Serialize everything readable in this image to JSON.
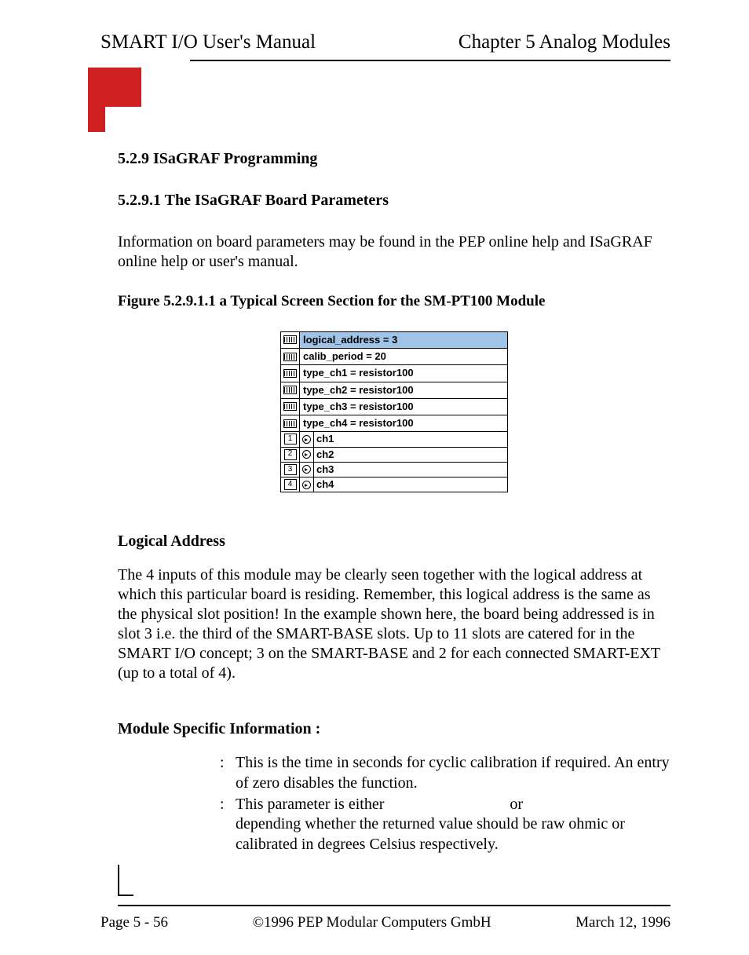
{
  "header": {
    "manual_title": "SMART I/O User's Manual",
    "chapter_title": "Chapter 5   Analog Modules"
  },
  "headings": {
    "h1": "5.2.9 ISaGRAF Programming",
    "h2": "5.2.9.1 The ISaGRAF Board Parameters",
    "intro_para": "Information on board parameters may be found in the PEP online help and ISaGRAF online help or user's manual.",
    "figure_title": "Figure 5.2.9.1.1 a Typical Screen Section for the SM-PT100 Module"
  },
  "screenshot": {
    "params": [
      {
        "text": "logical_address = 3",
        "highlight": true
      },
      {
        "text": "calib_period = 20",
        "highlight": false
      },
      {
        "text": "type_ch1 = resistor100",
        "highlight": false
      },
      {
        "text": "type_ch2 = resistor100",
        "highlight": false
      },
      {
        "text": "type_ch3 = resistor100",
        "highlight": false
      },
      {
        "text": "type_ch4 = resistor100",
        "highlight": false
      }
    ],
    "channels": [
      {
        "num": "1",
        "label": "ch1"
      },
      {
        "num": "2",
        "label": "ch2"
      },
      {
        "num": "3",
        "label": "ch3"
      },
      {
        "num": "4",
        "label": "ch4"
      }
    ]
  },
  "logical_address": {
    "title": "Logical Address",
    "text": "The 4 inputs of this module may be clearly seen together with the logical address at which this particular board is residing. Remember, this logical address is the same as the physical slot position! In the example shown here, the board being addressed is in slot 3 i.e. the third of the SMART-BASE slots. Up to 11 slots are catered for in the SMART I/O concept; 3 on the SMART-BASE and 2 for each connected SMART-EXT (up to a total of 4)."
  },
  "module_info": {
    "title": "Module Specific Information :",
    "rows": [
      {
        "term": "",
        "colon": ":",
        "desc": "This is the time in seconds for cyclic calibration if required. An entry of zero disables the function."
      },
      {
        "term": "",
        "colon": ":",
        "desc_pre": "This parameter is either ",
        "desc_mid": "                               or",
        "desc_post": "depending whether the returned value should be raw ohmic or calibrated in degrees Celsius respectively."
      }
    ]
  },
  "footer": {
    "page": "Page 5 - 56",
    "copyright": "©1996 PEP Modular Computers GmbH",
    "date": "March 12, 1996"
  }
}
